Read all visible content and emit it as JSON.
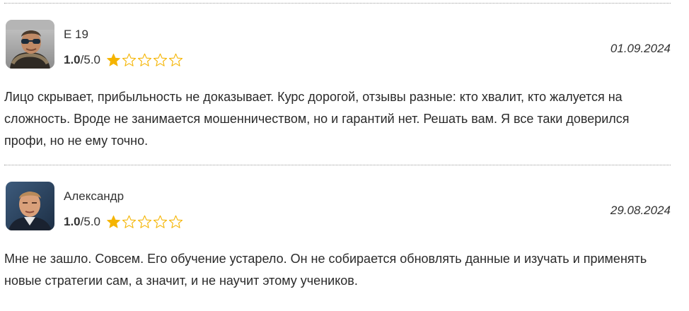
{
  "reviews": [
    {
      "author": "E 19",
      "score": "1.0",
      "max": "/5.0",
      "rating_value": 1,
      "date": "01.09.2024",
      "avatar_icon": "user-photo-sunglasses",
      "text": "Лицо скрывает, прибыльность не доказывает. Курс дорогой, отзывы разные: кто хвалит, кто жалуется на сложность. Вроде не занимается мошенничеством, но и гарантий нет. Решать вам. Я все таки доверился профи, но не ему точно."
    },
    {
      "author": "Александр",
      "score": "1.0",
      "max": "/5.0",
      "rating_value": 1,
      "date": "29.08.2024",
      "avatar_icon": "user-photo-man",
      "text": "Мне не зашло. Совсем. Его обучение устарело. Он не собирается обновлять данные и изучать и применять новые стратегии сам, а значит, и не научит этому учеников."
    }
  ],
  "colors": {
    "star_filled": "#f5b400",
    "star_empty_outline": "#f5b400",
    "divider": "#9a9a9a"
  }
}
